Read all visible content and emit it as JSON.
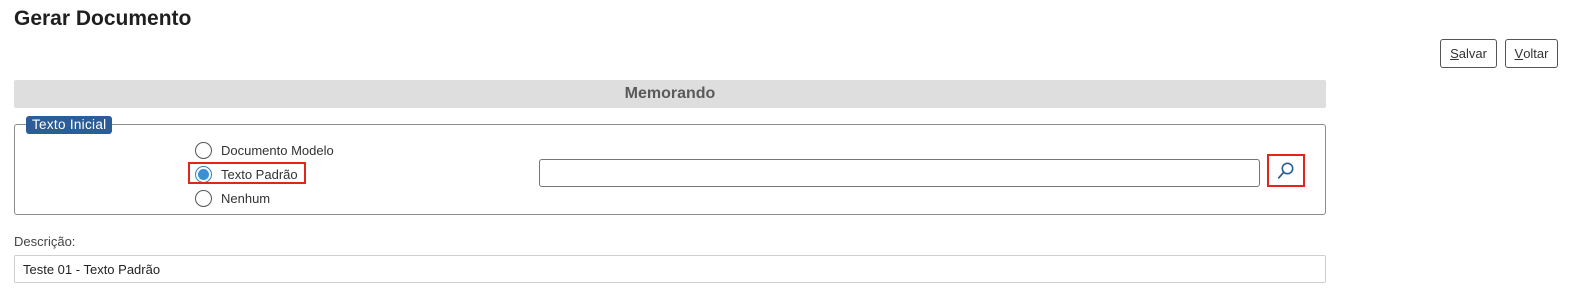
{
  "page": {
    "title": "Gerar Documento"
  },
  "toolbar": {
    "save": {
      "accel": "S",
      "rest": "alvar"
    },
    "back": {
      "accel": "V",
      "rest": "oltar"
    }
  },
  "section": {
    "title": "Memorando"
  },
  "texto_inicial": {
    "legend": "Texto Inicial",
    "options": [
      {
        "label": "Documento Modelo",
        "selected": false
      },
      {
        "label": "Texto Padrão",
        "selected": true
      },
      {
        "label": "Nenhum",
        "selected": false
      }
    ],
    "template_value": "",
    "search_icon": "magnifier-icon"
  },
  "descricao": {
    "label": "Descrição:",
    "value": "Teste 01 - Texto Padrão"
  },
  "colors": {
    "legend_bg": "#2c5d96",
    "highlight": "#e1251b",
    "radio_selected": "#3b8fd6",
    "section_bar": "#dedede"
  }
}
